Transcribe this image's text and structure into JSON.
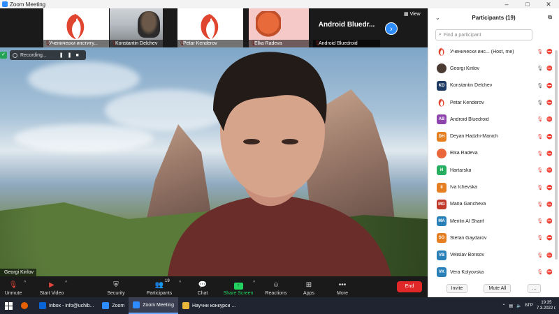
{
  "window": {
    "title": "Zoom Meeting",
    "min_icon": "minimize-icon",
    "max_icon": "maximize-icon",
    "close_icon": "close-icon"
  },
  "strip": {
    "tiles": [
      {
        "name": "Ученически институ...",
        "muted": true
      },
      {
        "name": "Konstantin Delchev",
        "muted": true
      },
      {
        "name": "Petar Kenderov",
        "muted": true
      },
      {
        "name": "Elka Radeva",
        "muted": true
      },
      {
        "name": "Android Bluedroid",
        "muted": true,
        "big": "Android  Bluedr..."
      }
    ],
    "view_label": "View"
  },
  "video": {
    "recording_label": "Recording...",
    "pause_icon": "pause-icon",
    "stop_icon": "stop-icon",
    "speaker_name": "Georgi Kirilov"
  },
  "toolbar": {
    "unmute": "Unmute",
    "start_video": "Start Video",
    "security": "Security",
    "participants": "Participants",
    "participants_count": "19",
    "chat": "Chat",
    "share_screen": "Share Screen",
    "reactions": "Reactions",
    "apps": "Apps",
    "more": "More",
    "end": "End"
  },
  "panel": {
    "title": "Participants (19)",
    "search_placeholder": "Find a participant",
    "participants": [
      {
        "name": "Ученически инс... (Host, me)",
        "initials": "",
        "color": "#ffffff",
        "logo": true,
        "mic": "off",
        "cam": "off"
      },
      {
        "name": "Georgi Kirilov",
        "initials": "",
        "color": "#4a3a32",
        "logo": false,
        "photo": true,
        "mic": "on",
        "cam": "off"
      },
      {
        "name": "Konstantin Delchev",
        "initials": "KD",
        "color": "#1f3b63",
        "logo": false,
        "mic": "on",
        "cam": "off"
      },
      {
        "name": "Petar Kenderov",
        "initials": "",
        "color": "#ffffff",
        "logo": true,
        "mic": "on",
        "cam": "off"
      },
      {
        "name": "Android Bluedroid",
        "initials": "AB",
        "color": "#8e44ad",
        "logo": false,
        "mic": "off",
        "cam": "off"
      },
      {
        "name": "Deyan Hadzhi-Manich",
        "initials": "DH",
        "color": "#e67e22",
        "logo": false,
        "mic": "off",
        "cam": "off"
      },
      {
        "name": "Elka Radeva",
        "initials": "",
        "color": "#e8663a",
        "logo": false,
        "photo": true,
        "mic": "off",
        "cam": "off"
      },
      {
        "name": "Hartarska",
        "initials": "H",
        "color": "#27ae60",
        "logo": false,
        "mic": "off",
        "cam": "off"
      },
      {
        "name": "Iva Ichevska",
        "initials": "II",
        "color": "#e67e22",
        "logo": false,
        "mic": "off",
        "cam": "off"
      },
      {
        "name": "Maria Gancheva",
        "initials": "MG",
        "color": "#c0392b",
        "logo": false,
        "mic": "off",
        "cam": "off"
      },
      {
        "name": "Merilin Al Sharif",
        "initials": "MA",
        "color": "#2980b9",
        "logo": false,
        "mic": "off",
        "cam": "off"
      },
      {
        "name": "Stefan Gaydarov",
        "initials": "SG",
        "color": "#e67e22",
        "logo": false,
        "mic": "off",
        "cam": "off"
      },
      {
        "name": "Velislav Borisov",
        "initials": "VB",
        "color": "#2980b9",
        "logo": false,
        "mic": "off",
        "cam": "off"
      },
      {
        "name": "Vera Kolyovska",
        "initials": "VK",
        "color": "#2980b9",
        "logo": false,
        "mic": "off",
        "cam": "off"
      }
    ],
    "invite": "Invite",
    "mute_all": "Mute All",
    "more": "..."
  },
  "taskbar": {
    "items": [
      {
        "label": "Inbox - info@uchib...",
        "color": "#0a64d6"
      },
      {
        "label": "Zoom",
        "color": "#2d8cff"
      },
      {
        "label": "Zoom Meeting",
        "color": "#2d8cff",
        "active": true
      },
      {
        "label": "Научни конкурси ...",
        "color": "#e8b73a"
      }
    ],
    "lang": "БГР",
    "time": "19:35",
    "date": "7.3.2022 г."
  }
}
